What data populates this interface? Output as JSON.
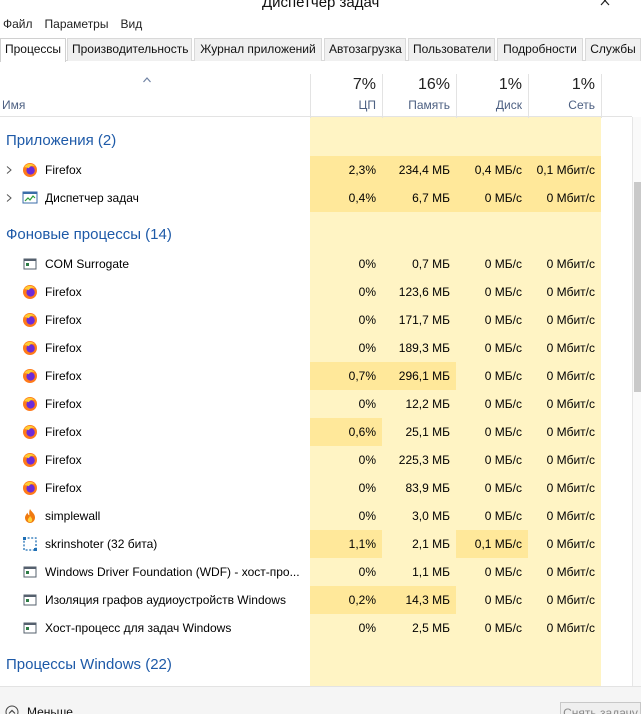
{
  "window": {
    "title": "Диспетчер задач"
  },
  "menu": [
    "Файл",
    "Параметры",
    "Вид"
  ],
  "tabs": [
    {
      "label": "Процессы",
      "active": true
    },
    {
      "label": "Производительность"
    },
    {
      "label": "Журнал приложений"
    },
    {
      "label": "Автозагрузка"
    },
    {
      "label": "Пользователи"
    },
    {
      "label": "Подробности"
    },
    {
      "label": "Службы"
    }
  ],
  "columns": {
    "name": "Имя",
    "cpu": {
      "percent": "7%",
      "label": "ЦП"
    },
    "memory": {
      "percent": "16%",
      "label": "Память"
    },
    "disk": {
      "percent": "1%",
      "label": "Диск"
    },
    "network": {
      "percent": "1%",
      "label": "Сеть"
    }
  },
  "groups": [
    {
      "label": "Приложения (2)",
      "rows": [
        {
          "name": "Firefox",
          "icon": "firefox-icon",
          "expandable": true,
          "cpu": "2,3%",
          "mem": "234,4 МБ",
          "disk": "0,4 МБ/с",
          "net": "0,1 Мбит/с",
          "hl": true
        },
        {
          "name": "Диспетчер задач",
          "icon": "task-manager-icon",
          "expandable": true,
          "cpu": "0,4%",
          "mem": "6,7 МБ",
          "disk": "0 МБ/с",
          "net": "0 Мбит/с",
          "hl": true
        }
      ]
    },
    {
      "label": "Фоновые процессы (14)",
      "rows": [
        {
          "name": "COM Surrogate",
          "icon": "app-window-icon",
          "cpu": "0%",
          "mem": "0,7 МБ",
          "disk": "0 МБ/с",
          "net": "0 Мбит/с"
        },
        {
          "name": "Firefox",
          "icon": "firefox-icon",
          "cpu": "0%",
          "mem": "123,6 МБ",
          "disk": "0 МБ/с",
          "net": "0 Мбит/с"
        },
        {
          "name": "Firefox",
          "icon": "firefox-icon",
          "cpu": "0%",
          "mem": "171,7 МБ",
          "disk": "0 МБ/с",
          "net": "0 Мбит/с"
        },
        {
          "name": "Firefox",
          "icon": "firefox-icon",
          "cpu": "0%",
          "mem": "189,3 МБ",
          "disk": "0 МБ/с",
          "net": "0 Мбит/с"
        },
        {
          "name": "Firefox",
          "icon": "firefox-icon",
          "cpu": "0,7%",
          "mem": "296,1 МБ",
          "disk": "0 МБ/с",
          "net": "0 Мбит/с",
          "hl": true
        },
        {
          "name": "Firefox",
          "icon": "firefox-icon",
          "cpu": "0%",
          "mem": "12,2 МБ",
          "disk": "0 МБ/с",
          "net": "0 Мбит/с"
        },
        {
          "name": "Firefox",
          "icon": "firefox-icon",
          "cpu": "0,6%",
          "mem": "25,1 МБ",
          "disk": "0 МБ/с",
          "net": "0 Мбит/с",
          "hl": true
        },
        {
          "name": "Firefox",
          "icon": "firefox-icon",
          "cpu": "0%",
          "mem": "225,3 МБ",
          "disk": "0 МБ/с",
          "net": "0 Мбит/с"
        },
        {
          "name": "Firefox",
          "icon": "firefox-icon",
          "cpu": "0%",
          "mem": "83,9 МБ",
          "disk": "0 МБ/с",
          "net": "0 Мбит/с"
        },
        {
          "name": "simplewall",
          "icon": "flame-icon",
          "cpu": "0%",
          "mem": "3,0 МБ",
          "disk": "0 МБ/с",
          "net": "0 Мбит/с"
        },
        {
          "name": "skrinshoter (32 бита)",
          "icon": "screenshot-frame-icon",
          "cpu": "1,1%",
          "mem": "2,1 МБ",
          "disk": "0,1 МБ/с",
          "net": "0 Мбит/с",
          "hl": true
        },
        {
          "name": "Windows Driver Foundation (WDF) - хост-про...",
          "icon": "app-window-icon",
          "cpu": "0%",
          "mem": "1,1 МБ",
          "disk": "0 МБ/с",
          "net": "0 Мбит/с"
        },
        {
          "name": "Изоляция графов аудиоустройств Windows",
          "icon": "app-window-icon",
          "cpu": "0,2%",
          "mem": "14,3 МБ",
          "disk": "0 МБ/с",
          "net": "0 Мбит/с",
          "hl": true
        },
        {
          "name": "Хост-процесс для задач Windows",
          "icon": "app-window-icon",
          "cpu": "0%",
          "mem": "2,5 МБ",
          "disk": "0 МБ/с",
          "net": "0 Мбит/с"
        }
      ]
    },
    {
      "label": "Процессы Windows (22)",
      "rows": []
    }
  ],
  "footer": {
    "fewer_label": "Меньше",
    "end_task_label": "Снять задачу"
  },
  "colors": {
    "group_text": "#1e5aa8",
    "column_bg": "#fff4c4",
    "column_highlight": "#ffe89a",
    "header_label": "#4d6082"
  }
}
